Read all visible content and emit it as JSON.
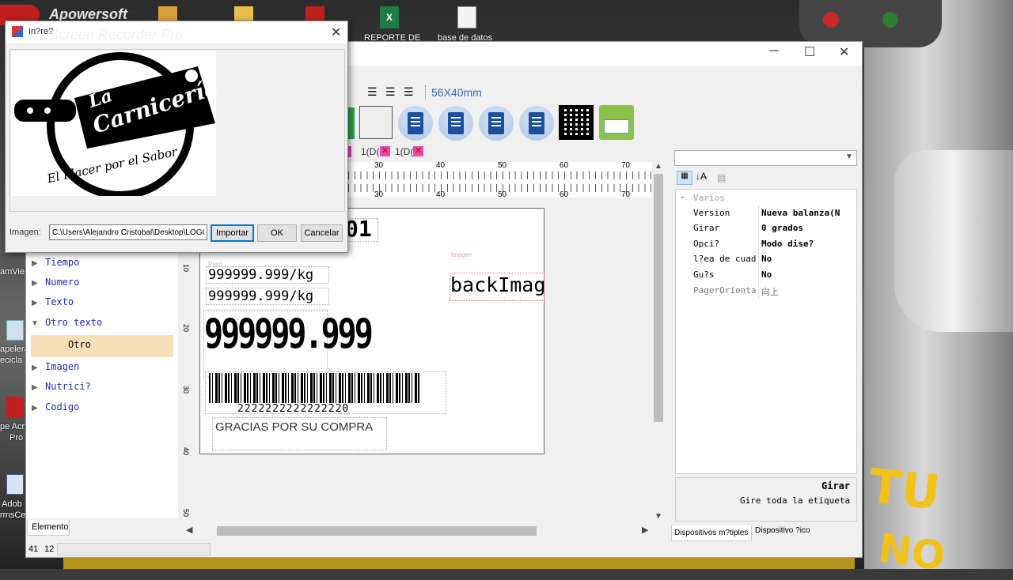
{
  "desktop": {
    "watermark_brand": "Apowersoft",
    "watermark_product": "Screen Recorder Pro",
    "icons": {
      "reporte": "REPORTE DE",
      "base_datos": "base de datos",
      "team_viewer": "amVie",
      "papelera_1": "apelera",
      "papelera_2": "ecicla",
      "acrobat_1": "pe Acr",
      "acrobat_2": "Pro",
      "adobe_1": "Adob",
      "adobe_2": "rmsCe"
    },
    "background_text": [
      "TU",
      "NO"
    ],
    "colors": {
      "yellow": "#f0c21a"
    }
  },
  "toolbar": {
    "size_label": "56X40mm",
    "align_icons": [
      "align-left-icon",
      "align-center-icon",
      "align-right-icon"
    ]
  },
  "tabs": [
    {
      "label": "1(D("
    },
    {
      "label": "1(D("
    }
  ],
  "ruler": {
    "top_ticks": [
      "30",
      "40",
      "50",
      "60",
      "70"
    ],
    "bottom_ticks": [
      "30",
      "40",
      "50",
      "60",
      "70"
    ],
    "left_ticks": [
      "10",
      "20",
      "30",
      "40",
      "50"
    ]
  },
  "tree": {
    "items": [
      {
        "label": "Tiempo"
      },
      {
        "label": "Numero"
      },
      {
        "label": "Texto"
      },
      {
        "label": "Otro texto",
        "expanded": true
      },
      {
        "label": "Otro",
        "child": true,
        "selected": true
      },
      {
        "label": "Imagen"
      },
      {
        "label": "Nutrici?"
      },
      {
        "label": "Codigo"
      }
    ],
    "tab_label": "Elemento"
  },
  "status": {
    "x": "41",
    "y": "12"
  },
  "label_canvas": {
    "top_partial": "01",
    "weight_1_caption": "Peso",
    "weight_1": "999999.999/kg",
    "weight_2": "999999.999/kg",
    "big_number": "999999.999",
    "image_caption": "Imagen",
    "back_image": "backImage",
    "barcode_number": "2222222222222220",
    "thanks": "GRACIAS POR SU COMPRA"
  },
  "properties": {
    "category": "Varios",
    "rows": [
      {
        "name": "Version",
        "value": "Nueva balanza(N"
      },
      {
        "name": "Girar",
        "value": "0 grados"
      },
      {
        "name": "Opci?",
        "value": "Modo dise?"
      },
      {
        "name": "l?ea de cuad",
        "value": "No"
      },
      {
        "name": "Gu?s",
        "value": "No"
      },
      {
        "name": "PagerOrienta",
        "value": "向上"
      }
    ],
    "description_title": "Girar",
    "description_text": "Gire toda la etiqueta",
    "tabs": [
      "Dispositivos m?tiples",
      "Dispositivo ?ico"
    ]
  },
  "dialog": {
    "title": "In?re?",
    "logo_line_1": "La",
    "logo_line_2": "Carnicería",
    "logo_slogan": "El Placer por el Sabor",
    "path_label": "Imagen:",
    "path_value": "C:\\Users\\Alejandro Cristobal\\Desktop\\LOGO",
    "import_button": "Importar",
    "ok_button": "OK",
    "cancel_button": "Cancelar"
  }
}
